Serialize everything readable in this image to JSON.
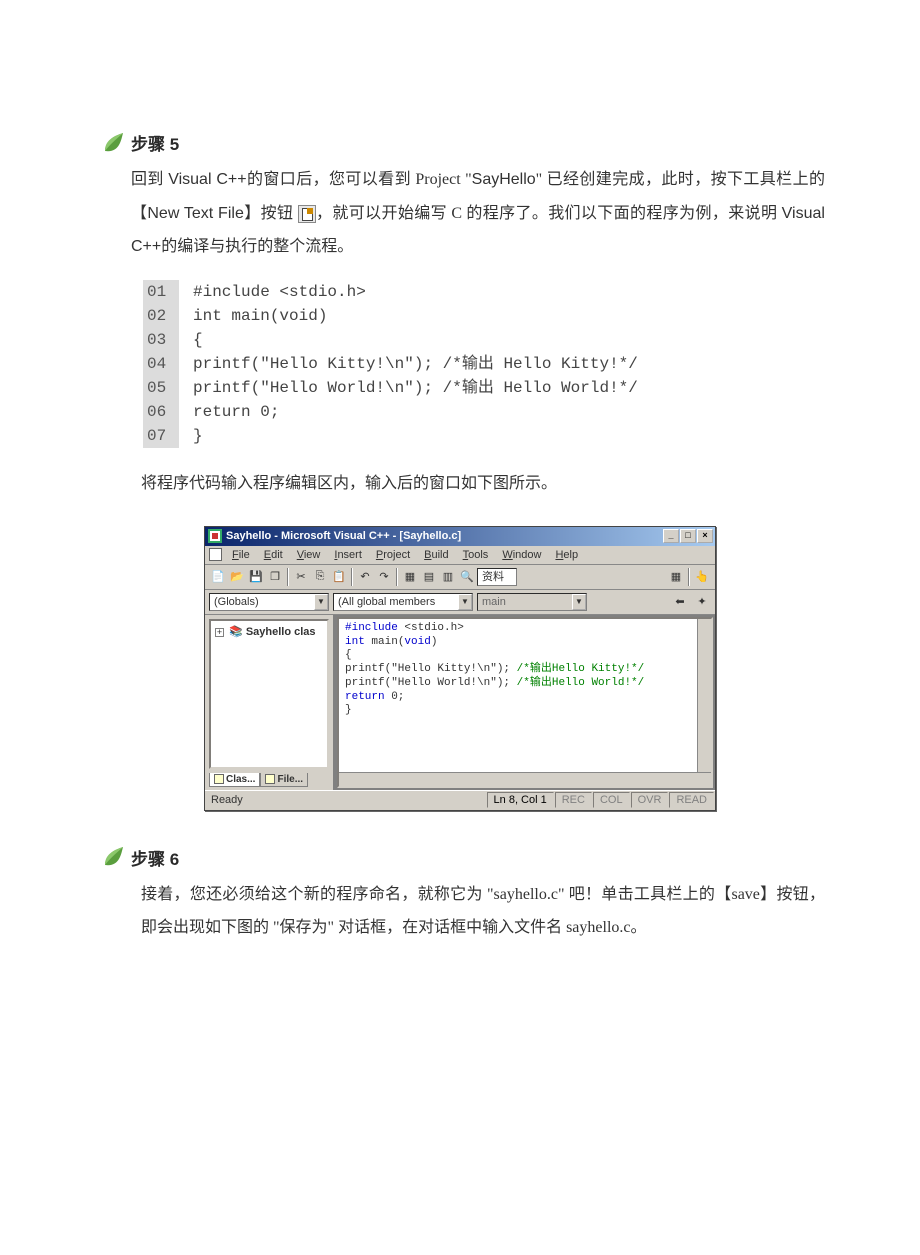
{
  "step5": {
    "title": "步骤 5",
    "p1_a": "回到 ",
    "p1_vc": "Visual C++",
    "p1_b": "的窗口后，您可以看到 Project \"",
    "p1_proj": "SayHello",
    "p1_c": "\" 已经创建完成，此时，按下工具栏上的【",
    "p1_btn": "New Text File",
    "p1_d": "】按钮 ",
    "p1_e": "，就可以开始编写 C 的程序了。我们以下面的程序为例，来说明 ",
    "p1_vc2": "Visual C++",
    "p1_f": "的编译与执行的整个流程。"
  },
  "code": {
    "lines": [
      {
        "n": "01",
        "t": "#include <stdio.h>"
      },
      {
        "n": "02",
        "t": "int main(void)"
      },
      {
        "n": "03",
        "t": "{"
      },
      {
        "n": "04",
        "t": "  printf(\"Hello Kitty!\\n\");   /*输出 Hello Kitty!*/"
      },
      {
        "n": "05",
        "t": "  printf(\"Hello World!\\n\");   /*输出 Hello World!*/"
      },
      {
        "n": "06",
        "t": "  return 0;"
      },
      {
        "n": "07",
        "t": "}"
      }
    ]
  },
  "caption1": "将程序代码输入程序编辑区内，输入后的窗口如下图所示。",
  "ide": {
    "title": "Sayhello - Microsoft Visual C++ - [Sayhello.c]",
    "menus": [
      "File",
      "Edit",
      "View",
      "Insert",
      "Project",
      "Build",
      "Tools",
      "Window",
      "Help"
    ],
    "toolbar_text": "资料",
    "combos": {
      "scope": "(Globals)",
      "members": "(All global members",
      "func": "main"
    },
    "tree_item": "Sayhello clas",
    "tabs": {
      "class": "Clas...",
      "file": "File..."
    },
    "editor": {
      "l1_a": "#include",
      "l1_b": " <stdio.h>",
      "l2_a": "int",
      "l2_b": " main(",
      "l2_c": "void",
      "l2_d": ")",
      "l3": "{",
      "l4_a": "    printf(\"Hello Kitty!\\n\");   ",
      "l4_c": "/*输出Hello Kitty!*/",
      "l5_a": "    printf(\"Hello World!\\n\");   ",
      "l5_c": "/*输出Hello World!*/",
      "l6_a": "    ",
      "l6_b": "return",
      "l6_c": " 0;",
      "l7": "}"
    },
    "status": {
      "ready": "Ready",
      "pos": "Ln 8, Col 1",
      "flags": [
        "REC",
        "COL",
        "OVR",
        "READ"
      ]
    }
  },
  "step6": {
    "title": "步骤 6",
    "text": "接着，您还必须给这个新的程序命名，就称它为 \"sayhello.c\" 吧！单击工具栏上的【save】按钮，即会出现如下图的 \"保存为\" 对话框，在对话框中输入文件名 sayhello.c。"
  }
}
